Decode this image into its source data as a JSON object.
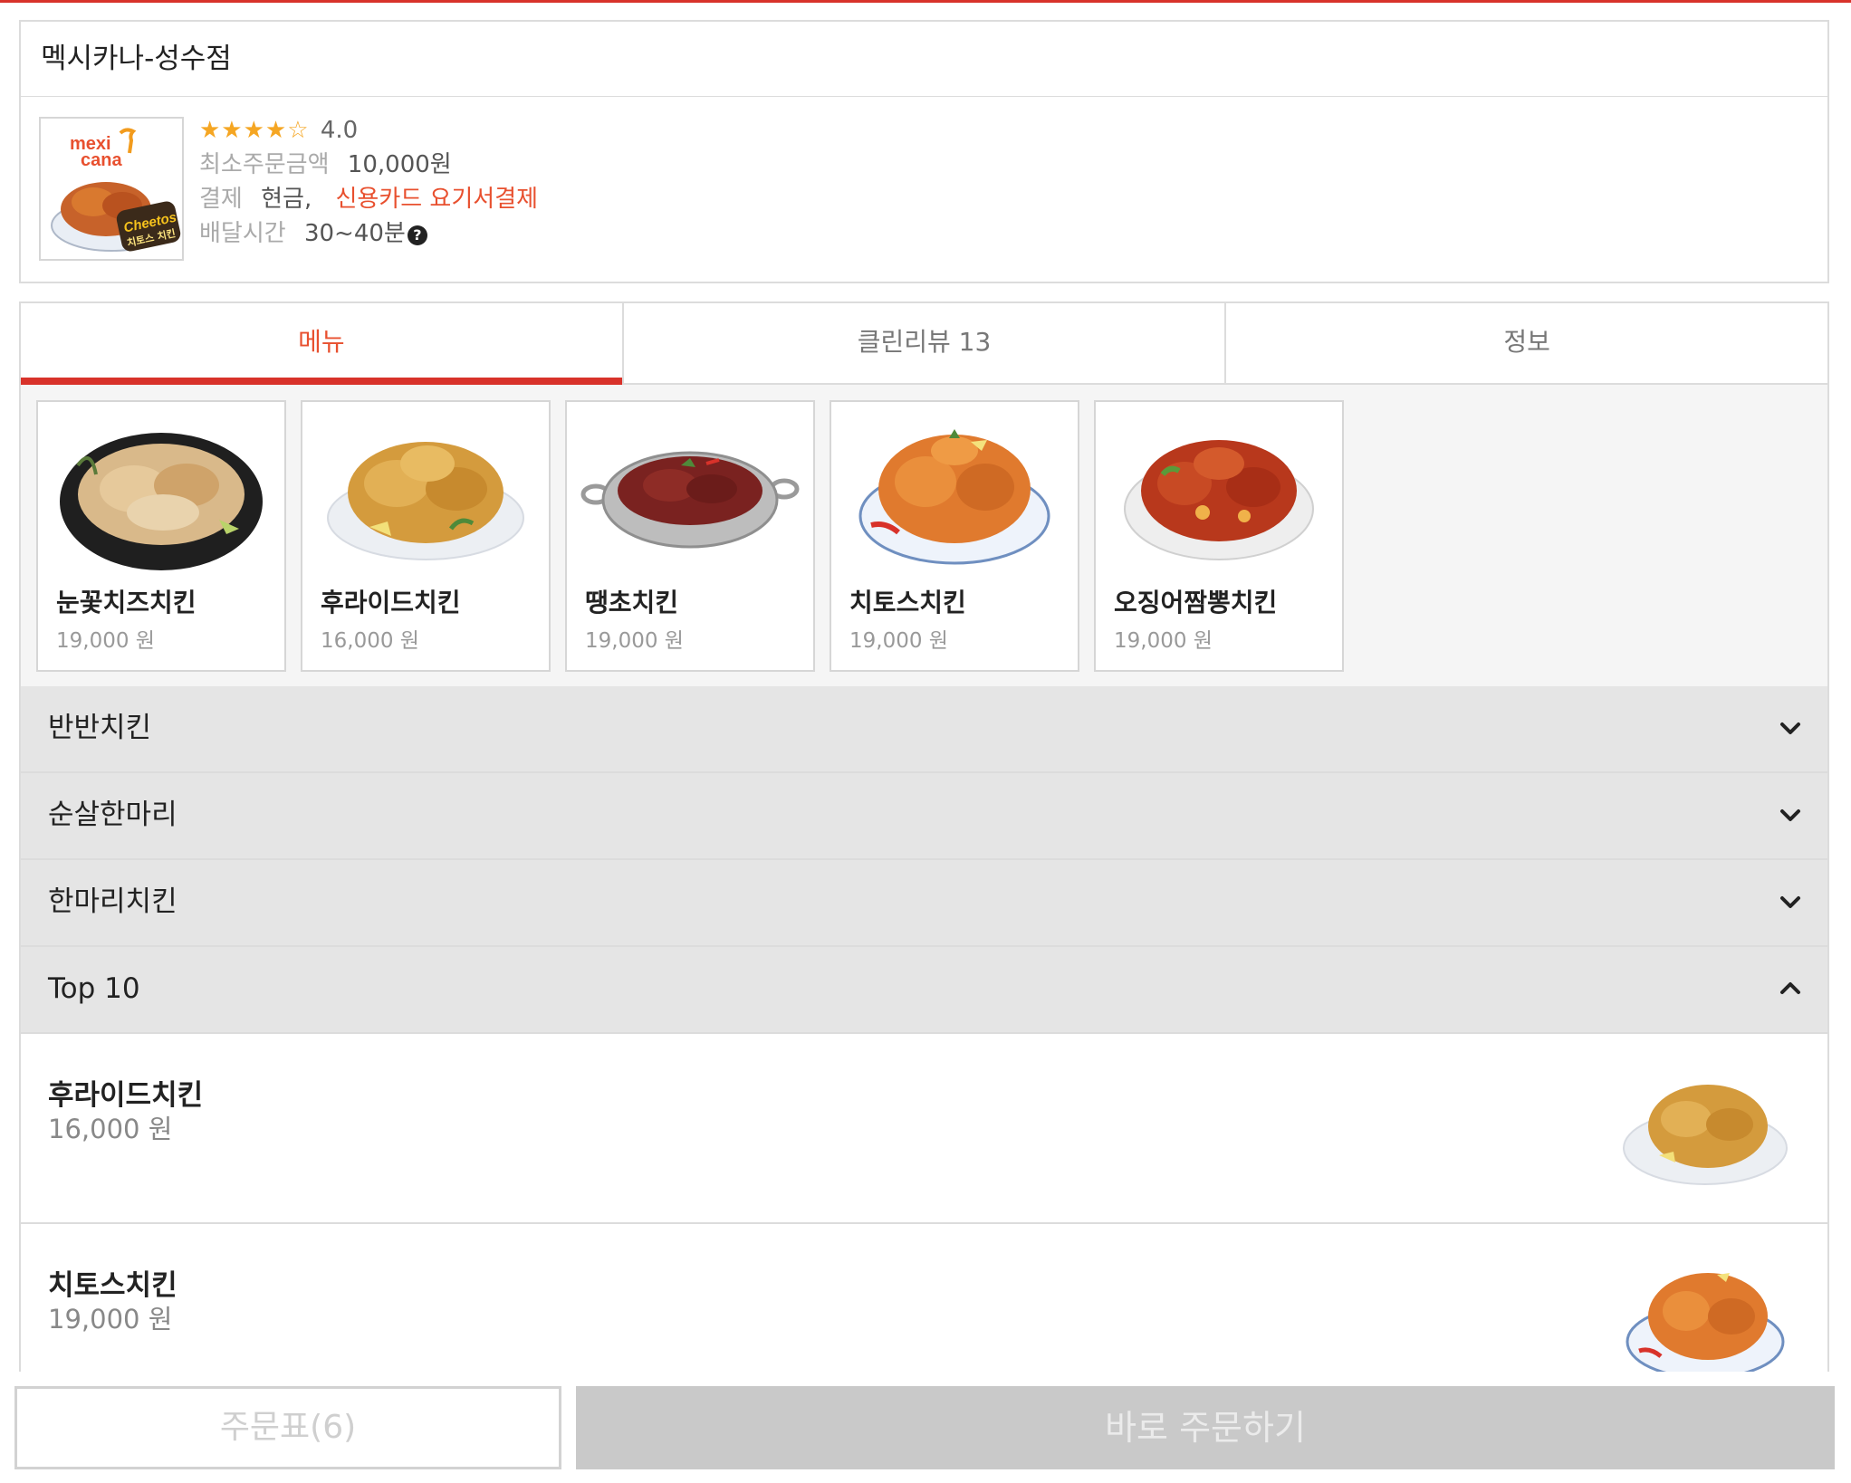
{
  "store": {
    "name": "멕시카나-성수점",
    "logo_text_top": "mexi",
    "logo_text_bottom": "cana",
    "logo_badge": "Cheetos",
    "logo_badge_sub": "치토스 치킨",
    "stars": "★★★★☆",
    "rating": "4.0",
    "min_order_label": "최소주문금액",
    "min_order_value": "10,000원",
    "payment_label": "결제",
    "payment_cash": "현금,",
    "payment_card": "신용카드 요기서결제",
    "delivery_label": "배달시간",
    "delivery_value": "30~40분",
    "help_icon": "?"
  },
  "tabs": [
    {
      "label": "메뉴",
      "active": true
    },
    {
      "label": "클린리뷰 13",
      "active": false
    },
    {
      "label": "정보",
      "active": false
    }
  ],
  "featured": [
    {
      "name": "눈꽃치즈치킨",
      "price": "19,000 원",
      "icon": "snow-cheese-chicken-image"
    },
    {
      "name": "후라이드치킨",
      "price": "16,000 원",
      "icon": "fried-chicken-image"
    },
    {
      "name": "땡초치킨",
      "price": "19,000 원",
      "icon": "spicy-chicken-pan-image"
    },
    {
      "name": "치토스치킨",
      "price": "19,000 원",
      "icon": "cheetos-chicken-image"
    },
    {
      "name": "오징어짬뽕치킨",
      "price": "19,000 원",
      "icon": "squid-jjambbong-chicken-image"
    }
  ],
  "categories": [
    {
      "label": "반반치킨",
      "expanded": false
    },
    {
      "label": "순살한마리",
      "expanded": false
    },
    {
      "label": "한마리치킨",
      "expanded": false
    },
    {
      "label": "Top 10",
      "expanded": true
    }
  ],
  "top10_items": [
    {
      "name": "후라이드치킨",
      "price": "16,000 원"
    },
    {
      "name": "치토스치킨",
      "price": "19,000 원"
    }
  ],
  "bottom": {
    "cart_label": "주문표(6)",
    "order_label": "바로 주문하기"
  },
  "colors": {
    "accent": "#d8322a",
    "accent_text": "#e8502f",
    "star": "#f5a623",
    "category_bg": "#e5e5e5",
    "disabled_button": "#c9c9c9"
  }
}
